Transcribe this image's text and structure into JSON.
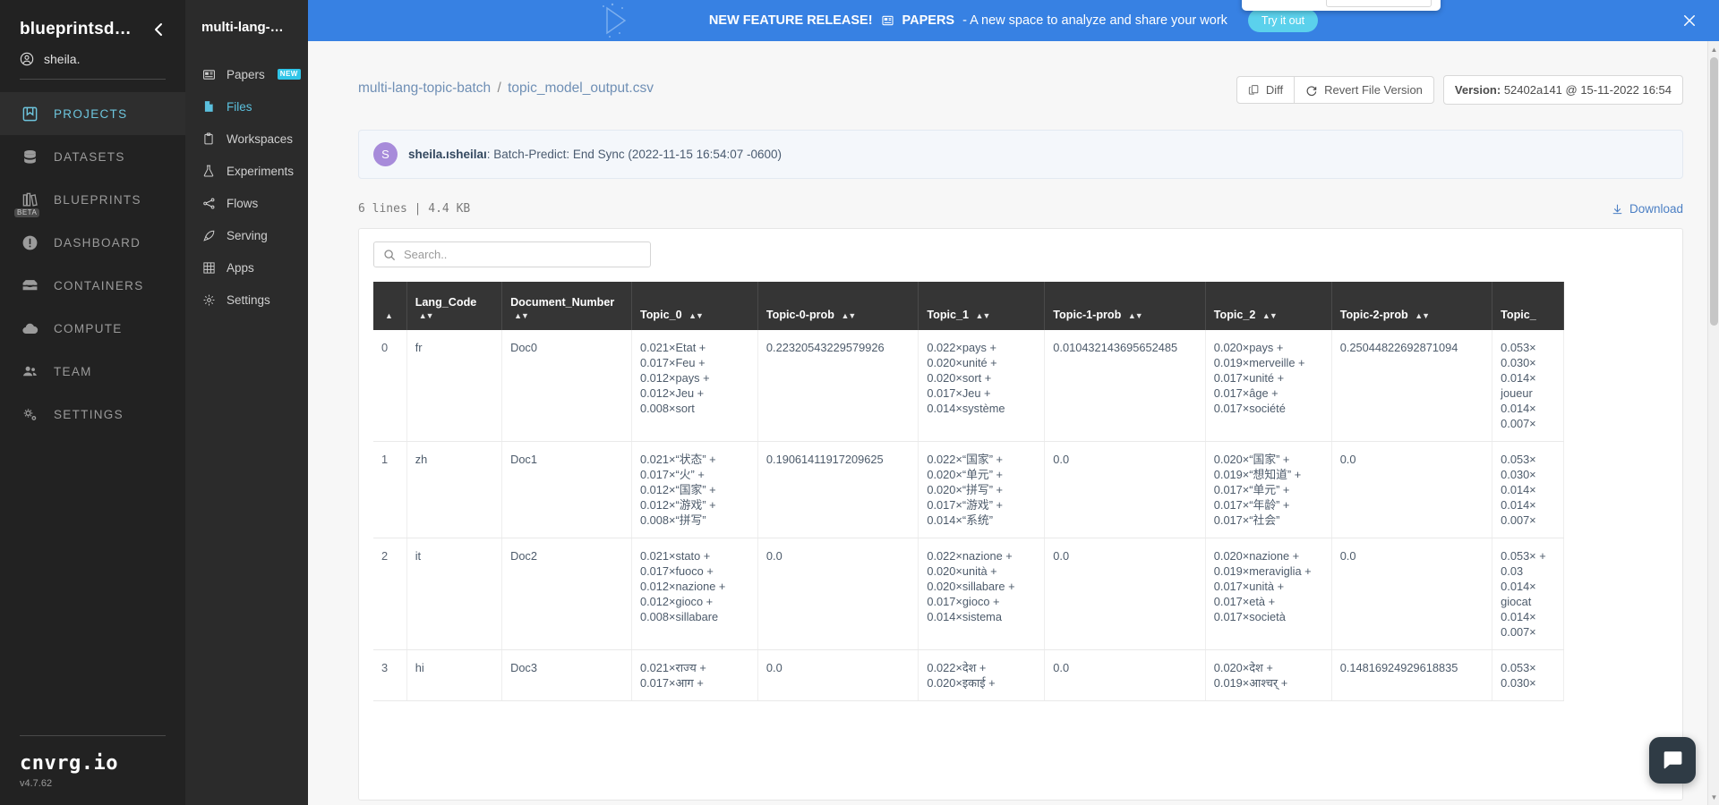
{
  "sidebar_primary": {
    "org_name": "blueprintsd…",
    "collapse_icon": "chevron-left-icon",
    "user": "sheila.",
    "items": [
      {
        "label": "PROJECTS",
        "icon": "projects-icon",
        "active": true
      },
      {
        "label": "DATASETS",
        "icon": "datasets-icon",
        "active": false
      },
      {
        "label": "BLUEPRINTS",
        "icon": "blueprints-icon",
        "badge": "BETA",
        "active": false
      },
      {
        "label": "DASHBOARD",
        "icon": "dashboard-icon",
        "active": false
      },
      {
        "label": "CONTAINERS",
        "icon": "containers-icon",
        "active": false
      },
      {
        "label": "COMPUTE",
        "icon": "compute-icon",
        "active": false
      },
      {
        "label": "TEAM",
        "icon": "team-icon",
        "active": false
      },
      {
        "label": "SETTINGS",
        "icon": "settings-icon",
        "active": false
      }
    ],
    "footer": {
      "logo": "cnvrg.io",
      "version": "v4.7.62"
    }
  },
  "sidebar_secondary": {
    "project_title": "multi-lang-…",
    "items": [
      {
        "label": "Papers",
        "icon": "papers-icon",
        "badge": "NEW",
        "active": false
      },
      {
        "label": "Files",
        "icon": "file-icon",
        "active": true
      },
      {
        "label": "Workspaces",
        "icon": "clipboard-icon",
        "active": false
      },
      {
        "label": "Experiments",
        "icon": "flask-icon",
        "active": false
      },
      {
        "label": "Flows",
        "icon": "flows-icon",
        "active": false
      },
      {
        "label": "Serving",
        "icon": "rocket-icon",
        "active": false
      },
      {
        "label": "Apps",
        "icon": "grid-icon",
        "active": false
      },
      {
        "label": "Settings",
        "icon": "gear-icon",
        "active": false
      }
    ]
  },
  "banner": {
    "headline": "NEW FEATURE RELEASE!",
    "papers_icon": "papers-icon",
    "product": "PAPERS",
    "tagline": "- A new space to analyze and share your work",
    "cta_label": "Try it out",
    "close_icon": "close-icon",
    "bg_color": "#3781e3",
    "cta_color": "#5bd1ec"
  },
  "header": {
    "breadcrumb": {
      "project": "multi-lang-topic-batch",
      "separator": "/",
      "file": "topic_model_output.csv"
    },
    "buttons": [
      {
        "label": "Diff",
        "icon": "diff-icon"
      },
      {
        "label": "Revert File Version",
        "icon": "revert-icon"
      }
    ],
    "version": {
      "label": "Version:",
      "value": "52402a141 @ 15-11-2022 16:54"
    }
  },
  "commit": {
    "avatar_initial": "S",
    "author": "sheila.ısheilaı",
    "message": ": Batch-Predict: End Sync (2022-11-15 16:54:07 -0600)"
  },
  "file_meta": {
    "text": "6 lines | 4.4 KB",
    "download_label": "Download",
    "download_icon": "download-icon"
  },
  "search": {
    "placeholder": "Search..",
    "value": "",
    "icon": "search-icon"
  },
  "chat": {
    "icon": "chat-icon"
  },
  "scrollbar": {
    "up_icon": "caret-up-icon",
    "down_icon": "caret-down-icon"
  },
  "table": {
    "sort_icon": "sort-icon",
    "columns": [
      {
        "key": "idx",
        "label": "",
        "sortable": true,
        "cls": "col-idx"
      },
      {
        "key": "lang",
        "label": "Lang_Code",
        "sortable": true,
        "cls": "col-lang"
      },
      {
        "key": "doc",
        "label": "Document_Number",
        "sortable": true,
        "cls": "col-doc"
      },
      {
        "key": "topic0",
        "label": "Topic_0",
        "sortable": true,
        "cls": "col-topic"
      },
      {
        "key": "topic0p",
        "label": "Topic-0-prob",
        "sortable": true,
        "cls": "col-prob"
      },
      {
        "key": "topic1",
        "label": "Topic_1",
        "sortable": true,
        "cls": "col-topic"
      },
      {
        "key": "topic1p",
        "label": "Topic-1-prob",
        "sortable": true,
        "cls": "col-prob"
      },
      {
        "key": "topic2",
        "label": "Topic_2",
        "sortable": true,
        "cls": "col-topic"
      },
      {
        "key": "topic2p",
        "label": "Topic-2-prob",
        "sortable": true,
        "cls": "col-prob"
      },
      {
        "key": "topic3",
        "label": "Topic_",
        "sortable": false,
        "cls": "col-last"
      }
    ],
    "rows": [
      {
        "idx": "0",
        "lang": "fr",
        "doc": "Doc0",
        "topic0": "0.021×Etat + 0.017×Feu + 0.012×pays + 0.012×Jeu + 0.008×sort",
        "topic0p": "0.22320543229579926",
        "topic1": "0.022×pays + 0.020×unité + 0.020×sort + 0.017×Jeu + 0.014×système",
        "topic1p": "0.010432143695652485",
        "topic2": "0.020×pays + 0.019×merveille + 0.017×unité + 0.017×âge + 0.017×société",
        "topic2p": "0.25044822692871094",
        "topic3": "0.053× 0.030× 0.014× joueur 0.014× 0.007×"
      },
      {
        "idx": "1",
        "lang": "zh",
        "doc": "Doc1",
        "topic0": "0.021×“状态” + 0.017×“火” + 0.012×“国家” + 0.012×“游戏” + 0.008×“拼写”",
        "topic0p": "0.19061411917209625",
        "topic1": "0.022×“国家” + 0.020×“单元” + 0.020×“拼写” + 0.017×“游戏” + 0.014×“系统”",
        "topic1p": "0.0",
        "topic2": "0.020×“国家” + 0.019×“想知道” + 0.017×“单元” + 0.017×“年龄” + 0.017×“社会”",
        "topic2p": "0.0",
        "topic3": "0.053× 0.030× 0.014× 0.014× 0.007×"
      },
      {
        "idx": "2",
        "lang": "it",
        "doc": "Doc2",
        "topic0": "0.021×stato + 0.017×fuoco + 0.012×nazione + 0.012×gioco + 0.008×sillabare",
        "topic0p": "0.0",
        "topic1": "0.022×nazione + 0.020×unità + 0.020×sillabare + 0.017×gioco + 0.014×sistema",
        "topic1p": "0.0",
        "topic2": "0.020×nazione + 0.019×meraviglia + 0.017×unità + 0.017×età + 0.017×società",
        "topic2p": "0.0",
        "topic3": "0.053× + 0.03 0.014× giocat 0.014× 0.007×"
      },
      {
        "idx": "3",
        "lang": "hi",
        "doc": "Doc3",
        "topic0": "0.021×राज्य + 0.017×आग +",
        "topic0p": "0.0",
        "topic1": "0.022×देश + 0.020×इकाई +",
        "topic1p": "0.0",
        "topic2": "0.020×देश + 0.019×आश्चर् +",
        "topic2p": "0.14816924929618835",
        "topic3": "0.053× 0.030×"
      }
    ]
  }
}
